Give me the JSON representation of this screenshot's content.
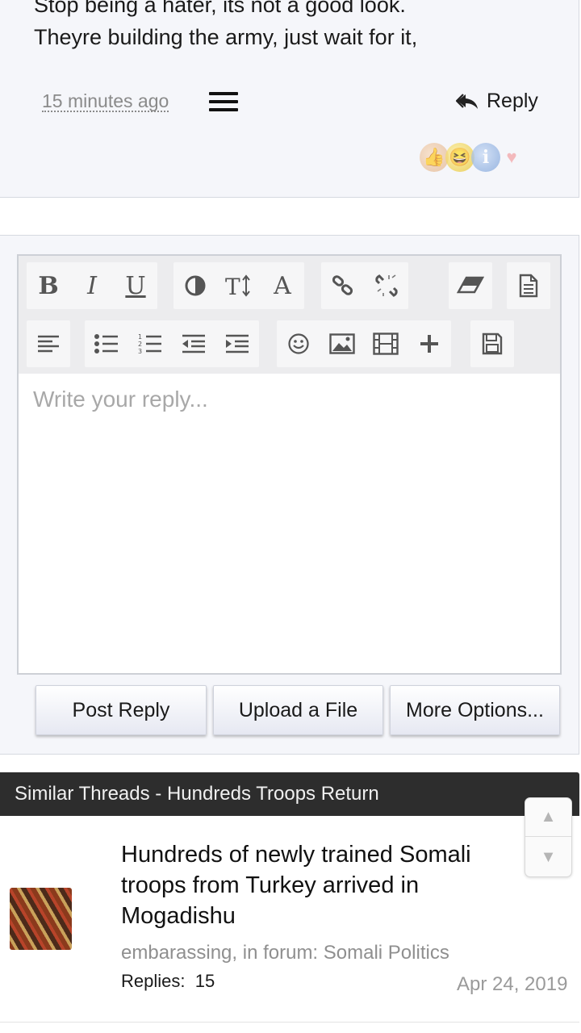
{
  "post": {
    "lines": [
      "Stop being a hater, its not a good look.",
      "Theyre building the army, just wait for it,"
    ],
    "time": "15 minutes ago",
    "reply_label": "Reply",
    "reactions": [
      "like-icon",
      "laugh-icon",
      "info-icon",
      "love-icon"
    ]
  },
  "editor": {
    "placeholder": "Write your reply...",
    "toolbar_row1": [
      "bold",
      "italic",
      "underline",
      "text-color",
      "font-size",
      "font-family",
      "link",
      "unlink",
      "remove-format",
      "paste-as-text"
    ],
    "toolbar_row2": [
      "align",
      "bulleted-list",
      "numbered-list",
      "outdent",
      "indent",
      "smilies",
      "image",
      "media",
      "insert",
      "drafts"
    ],
    "glyphs": {
      "bold": "B",
      "italic": "I",
      "underline": "U",
      "font_family": "A"
    }
  },
  "actions": {
    "post_reply": "Post Reply",
    "upload_file": "Upload a File",
    "more_options": "More Options..."
  },
  "similar": {
    "header": "Similar Threads - Hundreds Troops Return",
    "threads": [
      {
        "title": "Hundreds of newly trained Somali troops from Turkey arrived in Mogadishu",
        "meta": "embarassing, in forum: Somali Politics",
        "replies_label": "Replies:",
        "replies": "15",
        "date": "Apr 24, 2019"
      }
    ]
  },
  "scroll": {
    "up": "▲",
    "down": "▼"
  }
}
